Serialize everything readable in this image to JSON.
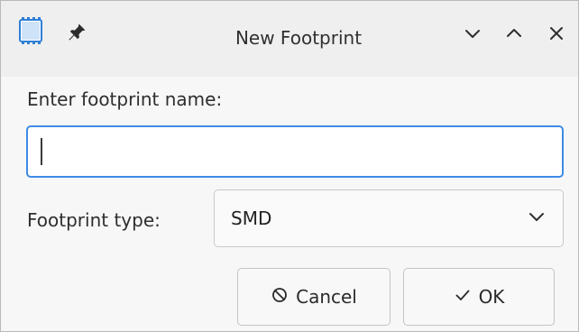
{
  "window": {
    "title": "New Footprint",
    "app_icon": "footprint-icon",
    "pin_icon": "pin-icon",
    "controls": {
      "minimize": "chevron-down-icon",
      "maximize": "chevron-up-icon",
      "close": "close-icon"
    }
  },
  "form": {
    "name_label": "Enter footprint name:",
    "name_value": "",
    "type_label": "Footprint type:",
    "type_value": "SMD",
    "type_dropdown_icon": "chevron-down-icon"
  },
  "buttons": {
    "cancel_label": "Cancel",
    "cancel_icon": "cancel-icon",
    "ok_label": "OK",
    "ok_icon": "check-icon"
  },
  "colors": {
    "focus_border": "#3d8be5",
    "app_icon_blue": "#2f7fd8"
  }
}
